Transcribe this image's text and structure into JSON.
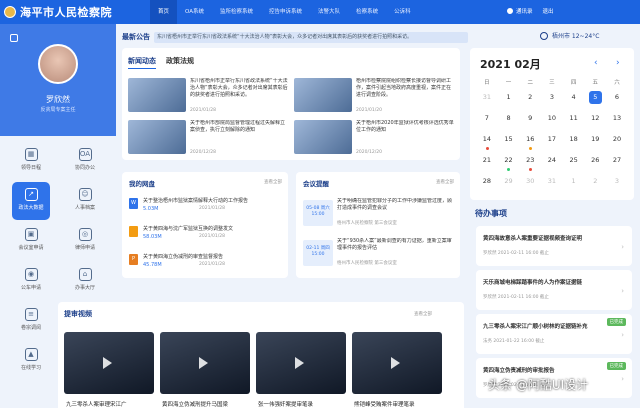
{
  "header": {
    "site_title": "海平市人民检察院",
    "nav": [
      "首页",
      "OA系统",
      "监所检察系统",
      "控告申诉系统",
      "法警大队",
      "检察系统",
      "公诉科"
    ],
    "user_label": "通讯录",
    "exit_label": "退出"
  },
  "sidebar": {
    "user_name": "罗欣然",
    "user_role": "反贪局专案主任",
    "menu": [
      {
        "label": "领导日程",
        "icon": "calendar-icon"
      },
      {
        "label": "协同办公",
        "icon": "oa-icon"
      },
      {
        "label": "政法大数据",
        "icon": "share-icon"
      },
      {
        "label": "人事档案",
        "icon": "person-icon"
      },
      {
        "label": "会议室申请",
        "icon": "meeting-icon"
      },
      {
        "label": "律师申请",
        "icon": "lawyer-icon"
      },
      {
        "label": "公车申请",
        "icon": "car-icon"
      },
      {
        "label": "办事大厅",
        "icon": "hall-icon"
      },
      {
        "label": "卷宗调阅",
        "icon": "file-icon"
      },
      {
        "label": "",
        "icon": "blank"
      },
      {
        "label": "在线学习",
        "icon": "study-icon"
      },
      {
        "label": "",
        "icon": "blank"
      }
    ]
  },
  "ticker": {
    "title": "最新公告",
    "text": "东川省梧州市正举行东川省政法系统“十大法治人物”表彰大会，众多记者对出席其表彰后的获奖者进行拍照和采访。"
  },
  "weather": {
    "text": "梧州市 12~24°C"
  },
  "news": {
    "tabs": [
      "新闻动态",
      "政策法规"
    ],
    "items": [
      {
        "text": "东川省梧州市正举行东川省政法系统“十大法治人物”表彰大会，众多记者对出席其表彰后的获奖者进行拍照和采访。",
        "date": "2021/01/28"
      },
      {
        "text": "梧州市检察院院组织检察长接访督导调研工作，案件引起当地政府高度重视，案件正在进行调查阶段。",
        "date": "2021/01/20"
      },
      {
        "text": "关于梧州市部院局监督管理过程过失解释立案侦查，执行立刻解除的通知",
        "date": "2020/12/28"
      },
      {
        "text": "关于梧州市2020年监狱评优考核评选优秀单位工作的通知",
        "date": "2020/12/20"
      }
    ]
  },
  "calendar": {
    "title": "2021  02月",
    "weekdays": [
      "日",
      "一",
      "二",
      "三",
      "四",
      "五",
      "六"
    ],
    "days": [
      {
        "d": "31",
        "out": true
      },
      {
        "d": "1"
      },
      {
        "d": "2"
      },
      {
        "d": "3"
      },
      {
        "d": "4"
      },
      {
        "d": "5",
        "today": true
      },
      {
        "d": "6"
      },
      {
        "d": "7"
      },
      {
        "d": "8"
      },
      {
        "d": "9"
      },
      {
        "d": "10"
      },
      {
        "d": "11"
      },
      {
        "d": "12"
      },
      {
        "d": "13"
      },
      {
        "d": "14",
        "dot": "#e74c3c"
      },
      {
        "d": "15"
      },
      {
        "d": "16",
        "dot": "#f39c12"
      },
      {
        "d": "17"
      },
      {
        "d": "18"
      },
      {
        "d": "19"
      },
      {
        "d": "20"
      },
      {
        "d": "21"
      },
      {
        "d": "22",
        "dot": "#2ecc71"
      },
      {
        "d": "23",
        "dot": "#e74c3c"
      },
      {
        "d": "24"
      },
      {
        "d": "25"
      },
      {
        "d": "26"
      },
      {
        "d": "27"
      },
      {
        "d": "28"
      },
      {
        "d": "29",
        "out": true
      },
      {
        "d": "30",
        "out": true
      },
      {
        "d": "31",
        "out": true
      },
      {
        "d": "1",
        "out": true
      },
      {
        "d": "2",
        "out": true
      },
      {
        "d": "3",
        "out": true
      }
    ]
  },
  "todo": {
    "title": "待办事项",
    "items": [
      {
        "title": "黄四海故意杀人案重要证据视频查询证明",
        "time": "罗欣然   2021-02-11 16:00 截止",
        "badge": ""
      },
      {
        "title": "天乐商城电梯踩踏事件的人为作案证据链",
        "time": "罗欣然   2021-02-11 16:00 截止",
        "badge": ""
      },
      {
        "title": "九三零杀人案宋江广顺小树林的证据链补充",
        "time": "法务   2021-01-22 16:00 截止",
        "badge": "已完成"
      },
      {
        "title": "黄四海立伪责减刑的审批报告",
        "time": "罗欣然   2021-02-11 16:00 截止",
        "badge": "已完成"
      }
    ]
  },
  "disk": {
    "title": "我的网盘",
    "more": "查看全部",
    "files": [
      {
        "name": "关于整治梧州市监狱案情解释大行动的工作报告",
        "size": "5.03M",
        "date": "2021/01/28",
        "color": "#2f73ea",
        "letter": "W"
      },
      {
        "name": "关于黄四海与沈广军监狱互换的调整发文",
        "size": "58.03M",
        "date": "2021/01/28",
        "color": "#f39c12",
        "letter": ""
      },
      {
        "name": "关于黄四海立伪减刑的审查监督报告",
        "size": "45.78M",
        "date": "2021/01/28",
        "color": "#e67e22",
        "letter": "P"
      }
    ]
  },
  "meeting": {
    "title": "会议提醒",
    "more": "查看全部",
    "items": [
      {
        "date": "05-08 周六 15:00",
        "text": "关于明确在监管犯罪分子的工作中涉嫌监管过度，顾打造成事件的调查会议",
        "loc": "梧州市人民检察院 第三会议室"
      },
      {
        "date": "02-11 周四 15:00",
        "text": "关于“930杀人案”最新调查的有力证据，重新立案审理事件的报告评估",
        "loc": "梧州市人民检察院 第三会议室"
      }
    ]
  },
  "videos": {
    "title": "提审视频",
    "more": "查看全部",
    "items": [
      {
        "caption": "九三零杀人案审理宋江广"
      },
      {
        "caption": "黄四海立伪减刑提升马国梁"
      },
      {
        "caption": "张一伟强奸案提审笔录"
      },
      {
        "caption": "熊铠峰受贿案件审理笔录"
      }
    ]
  },
  "watermark": {
    "text": "头条 @阿酷UI设计"
  }
}
